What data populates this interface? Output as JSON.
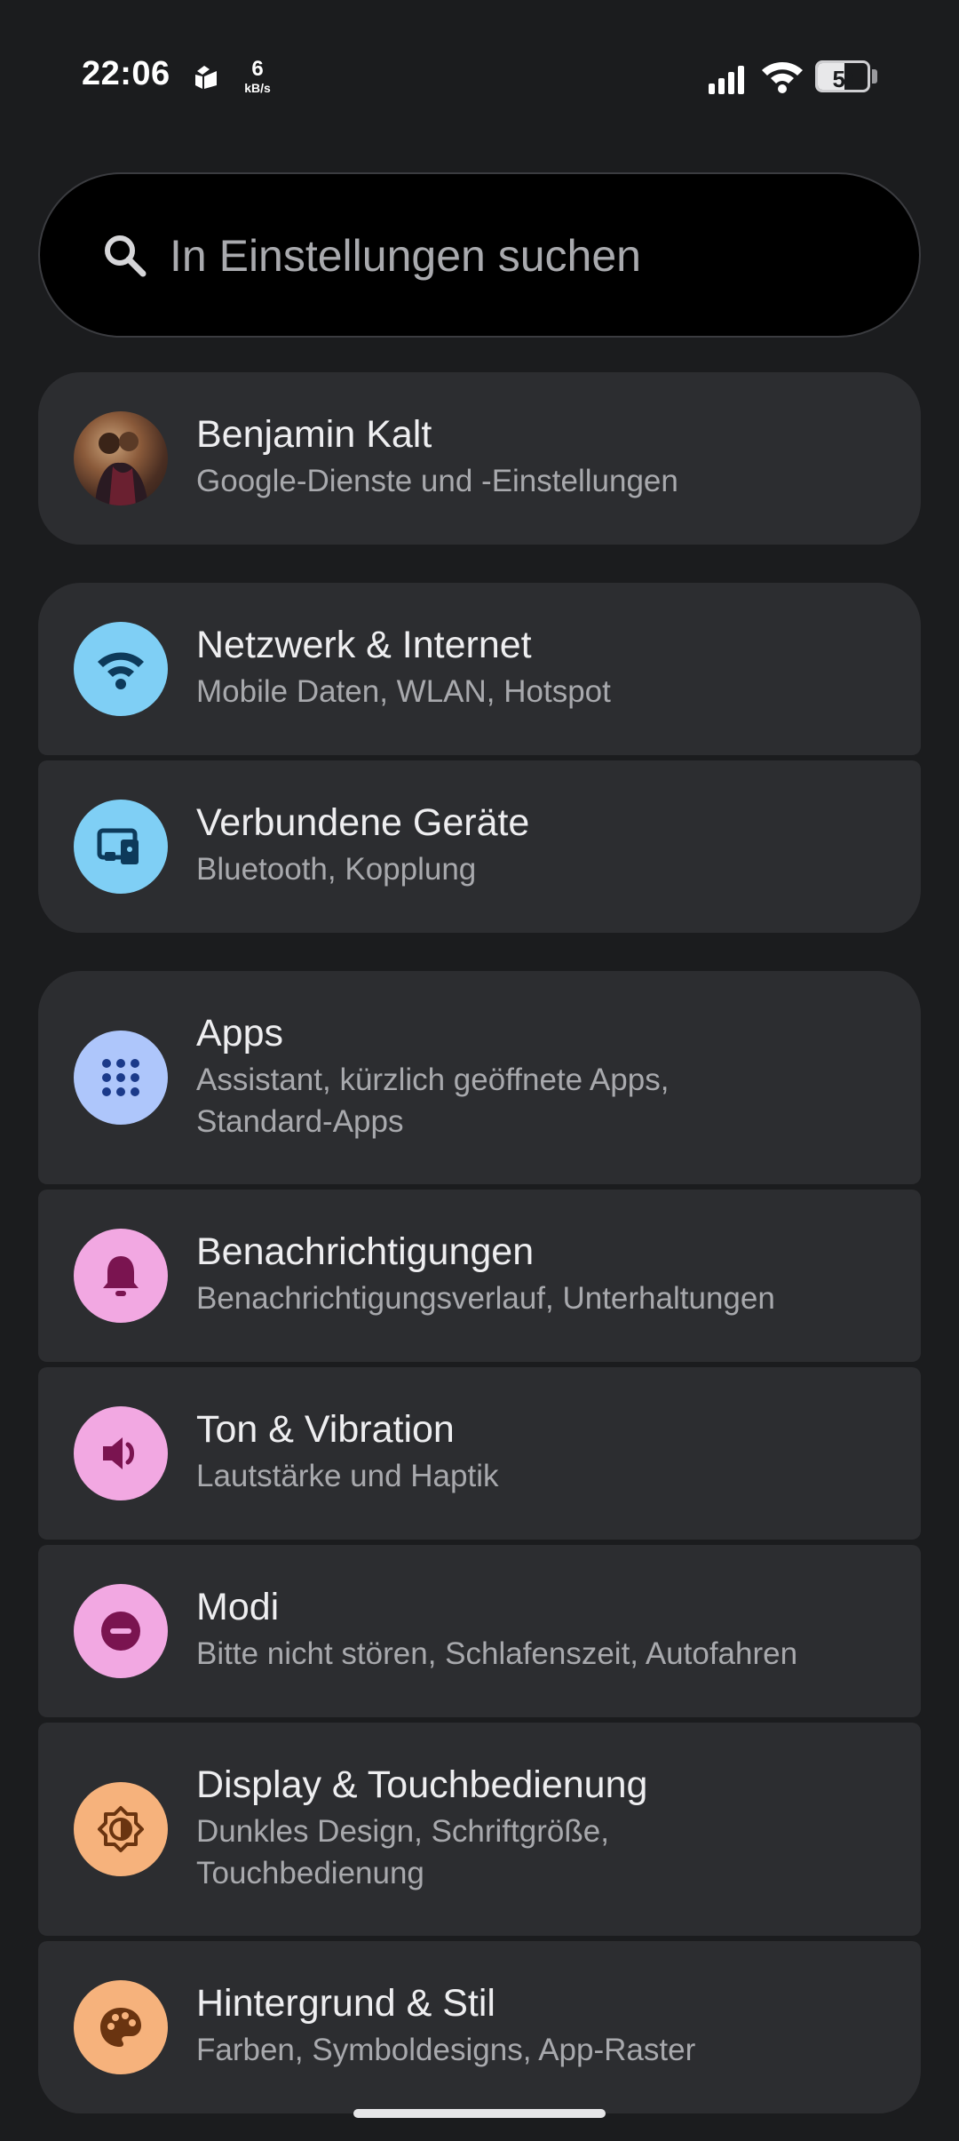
{
  "status_bar": {
    "time": "22:06",
    "net_speed_value": "6",
    "net_speed_unit": "kB/s",
    "battery_level": "54",
    "battery_fraction": 0.54
  },
  "search": {
    "placeholder": "In Einstellungen suchen"
  },
  "account": {
    "name": "Benjamin Kalt",
    "subtitle": "Google-Dienste und -Einstellungen"
  },
  "settings_items": [
    {
      "title": "Netzwerk & Internet",
      "subtitle": "Mobile Daten, WLAN, Hotspot",
      "icon": "wifi-icon",
      "icon_bg": "#7fcff5",
      "icon_fg": "#0d3a5a"
    },
    {
      "title": "Verbundene Geräte",
      "subtitle": "Bluetooth, Kopplung",
      "icon": "connected-devices-icon",
      "icon_bg": "#7fcff5",
      "icon_fg": "#0d3a5a"
    },
    {
      "title": "Apps",
      "subtitle_line1": "Assistant, kürzlich geöffnete Apps,",
      "subtitle_line2": "Standard-Apps",
      "icon": "apps-grid-icon",
      "icon_bg": "#aec6fb",
      "icon_fg": "#1b3a8a"
    },
    {
      "title": "Benachrichtigungen",
      "subtitle": "Benachrichtigungsverlauf, Unterhaltungen",
      "icon": "bell-icon",
      "icon_bg": "#f2a8e2",
      "icon_fg": "#7a1450"
    },
    {
      "title": "Ton & Vibration",
      "subtitle": "Lautstärke und Haptik",
      "icon": "volume-icon",
      "icon_bg": "#f2a8e2",
      "icon_fg": "#7a1450"
    },
    {
      "title": "Modi",
      "subtitle": "Bitte nicht stören, Schlafenszeit, Autofahren",
      "icon": "do-not-disturb-icon",
      "icon_bg": "#f2a8e2",
      "icon_fg": "#7a1450"
    },
    {
      "title": "Display & Touchbedienung",
      "subtitle_line1": "Dunkles Design, Schriftgröße,",
      "subtitle_line2": "Touchbedienung",
      "icon": "brightness-icon",
      "icon_bg": "#f6b27c",
      "icon_fg": "#6a3410"
    },
    {
      "title": "Hintergrund & Stil",
      "subtitle": "Farben, Symboldesigns, App-Raster",
      "icon": "palette-icon",
      "icon_bg": "#f6b27c",
      "icon_fg": "#6a3410"
    }
  ]
}
